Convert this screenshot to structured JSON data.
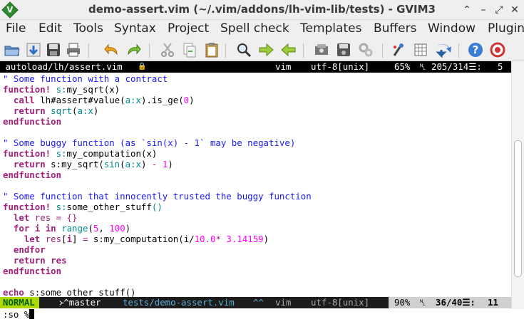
{
  "window": {
    "title": "demo-assert.vim (~/.vim/addons/lh-vim-lib/tests) - GVIM3",
    "app_icon_letter": "V",
    "buttons": [
      "⌃",
      "–",
      "⤢",
      "✕"
    ]
  },
  "menu": [
    "File",
    "Edit",
    "Tools",
    "Syntax",
    "Project",
    "Spell check",
    "Templates",
    "Buffers",
    "Window",
    "Plugin"
  ],
  "toolbar": {
    "icons": [
      "open-folder-icon",
      "download-icon",
      "save-icon",
      "print-icon",
      "undo-icon",
      "redo-icon",
      "cut-icon",
      "copy-icon",
      "paste-icon",
      "find-replace-icon",
      "forward-arrow-icon",
      "back-arrow-icon",
      "load-session-icon",
      "save-session-icon",
      "run-script-icon",
      "make-icon",
      "table-icon",
      "jump-icon",
      "help-icon",
      "find-help-icon"
    ]
  },
  "tabline": {
    "path": " autoload/lh/assert.vim",
    "lock": "🔒",
    "filetype": "vim",
    "encoding": "utf-8[unix]",
    "percent": "65%",
    "ln_symbol": "␤",
    "position": "205/314☰:",
    "column": "5"
  },
  "code_lines": [
    [
      [
        "cm",
        "\" Some function with a contract"
      ]
    ],
    [
      [
        "kw",
        "function!"
      ],
      [
        "txt",
        " "
      ],
      [
        "sc",
        "s:"
      ],
      [
        "txt",
        "my_sqrt(x)"
      ]
    ],
    [
      [
        "txt",
        "  "
      ],
      [
        "kw",
        "call"
      ],
      [
        "txt",
        " lh#assert#value("
      ],
      [
        "fn",
        "a:x"
      ],
      [
        "txt",
        ").is_ge("
      ],
      [
        "nm",
        "0"
      ],
      [
        "txt",
        ")"
      ]
    ],
    [
      [
        "txt",
        "  "
      ],
      [
        "kw",
        "return"
      ],
      [
        "txt",
        " "
      ],
      [
        "fn",
        "sqrt"
      ],
      [
        "txt",
        "("
      ],
      [
        "fn",
        "a:x"
      ],
      [
        "txt",
        ")"
      ]
    ],
    [
      [
        "kw",
        "endfunction"
      ]
    ],
    [
      [
        "txt",
        ""
      ]
    ],
    [
      [
        "cm",
        "\" Some buggy function (as `sin(x) - 1` may be negative)"
      ]
    ],
    [
      [
        "kw",
        "function!"
      ],
      [
        "txt",
        " "
      ],
      [
        "sc",
        "s:"
      ],
      [
        "txt",
        "my_computation(x)"
      ]
    ],
    [
      [
        "txt",
        "  "
      ],
      [
        "kw",
        "return"
      ],
      [
        "txt",
        " s:my_sqrt("
      ],
      [
        "fn",
        "sin"
      ],
      [
        "txt",
        "("
      ],
      [
        "fn",
        "a:x"
      ],
      [
        "txt",
        ") "
      ],
      [
        "st",
        "-"
      ],
      [
        "txt",
        " "
      ],
      [
        "nm",
        "1"
      ],
      [
        "txt",
        ")"
      ]
    ],
    [
      [
        "kw",
        "endfunction"
      ]
    ],
    [
      [
        "txt",
        ""
      ]
    ],
    [
      [
        "cm",
        "\" Some function that innocently trusted the buggy function"
      ]
    ],
    [
      [
        "kw",
        "function!"
      ],
      [
        "txt",
        " "
      ],
      [
        "sc",
        "s:"
      ],
      [
        "txt",
        "some_other_stuff"
      ],
      [
        "fn",
        "()"
      ]
    ],
    [
      [
        "txt",
        "  "
      ],
      [
        "kw",
        "let"
      ],
      [
        "txt",
        " "
      ],
      [
        "st",
        "res"
      ],
      [
        "txt",
        " "
      ],
      [
        "st",
        "="
      ],
      [
        "txt",
        " "
      ],
      [
        "st",
        "{}"
      ]
    ],
    [
      [
        "txt",
        "  "
      ],
      [
        "kw",
        "for"
      ],
      [
        "txt",
        " "
      ],
      [
        "kw",
        "i"
      ],
      [
        "txt",
        " "
      ],
      [
        "kw",
        "in"
      ],
      [
        "txt",
        " "
      ],
      [
        "fn",
        "range"
      ],
      [
        "txt",
        "("
      ],
      [
        "nm",
        "5"
      ],
      [
        "txt",
        ", "
      ],
      [
        "nm",
        "100"
      ],
      [
        "txt",
        ")"
      ]
    ],
    [
      [
        "txt",
        "    "
      ],
      [
        "kw",
        "let"
      ],
      [
        "txt",
        " "
      ],
      [
        "st",
        "res"
      ],
      [
        "txt",
        "["
      ],
      [
        "kw",
        "i"
      ],
      [
        "txt",
        "] "
      ],
      [
        "st",
        "="
      ],
      [
        "txt",
        " s:my_computation(i/"
      ],
      [
        "nm",
        "10.0"
      ],
      [
        "st",
        "*"
      ],
      [
        "txt",
        " "
      ],
      [
        "nm",
        "3.14159"
      ],
      [
        "txt",
        ")"
      ]
    ],
    [
      [
        "txt",
        "  "
      ],
      [
        "kw",
        "endfor"
      ]
    ],
    [
      [
        "txt",
        "  "
      ],
      [
        "kw",
        "return"
      ],
      [
        "txt",
        " "
      ],
      [
        "kw",
        "res"
      ]
    ],
    [
      [
        "kw",
        "endfunction"
      ]
    ],
    [
      [
        "txt",
        ""
      ]
    ],
    [
      [
        "kw",
        "echo"
      ],
      [
        "txt",
        " s:some_other_stuff()"
      ]
    ]
  ],
  "status": {
    "mode": "NORMAL",
    "branch": "᚛^master",
    "file": "tests/demo-assert.vim",
    "modified": "^^",
    "filetype": "vim",
    "encoding": "utf-8[unix]",
    "percent": "90%",
    "ln_symbol": "␤",
    "position": "36/40☰:",
    "column": "11"
  },
  "cmdline": ":so %"
}
